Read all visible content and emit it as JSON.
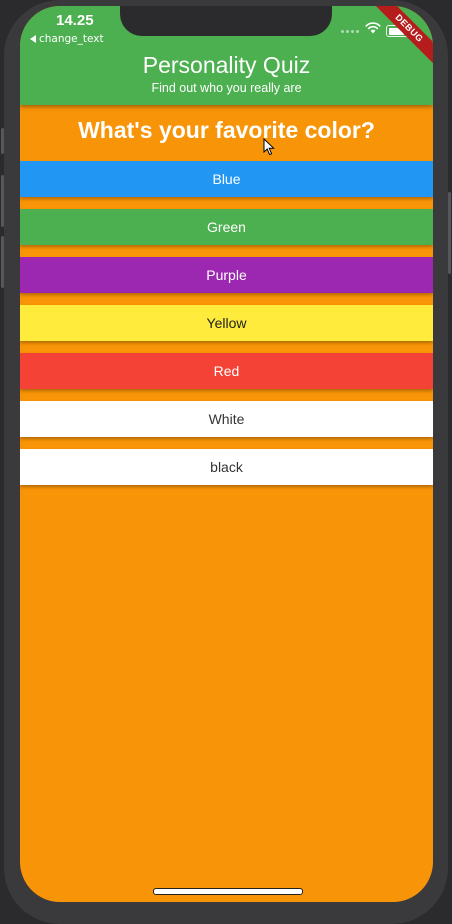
{
  "status_bar": {
    "time": "14.25",
    "back_app_label": "change_text",
    "debug_label": "DEBUG"
  },
  "app_bar": {
    "title": "Personality Quiz",
    "subtitle": "Find out who you really are",
    "color": "#4caf50"
  },
  "quiz": {
    "background": "#f89407",
    "question": "What's your favorite color?",
    "answers": [
      {
        "label": "Blue",
        "bg": "#2196f3",
        "fg": "#ffffff"
      },
      {
        "label": "Green",
        "bg": "#4caf50",
        "fg": "#ffffff"
      },
      {
        "label": "Purple",
        "bg": "#9c27b0",
        "fg": "#ffffff"
      },
      {
        "label": "Yellow",
        "bg": "#ffeb3b",
        "fg": "#222222"
      },
      {
        "label": "Red",
        "bg": "#f44336",
        "fg": "#ffffff"
      },
      {
        "label": "White",
        "bg": "#ffffff",
        "fg": "#333333"
      },
      {
        "label": "black",
        "bg": "#ffffff",
        "fg": "#333333"
      }
    ]
  },
  "icons": {
    "back": "back-triangle-icon",
    "wifi": "wifi-icon",
    "battery": "battery-icon",
    "cursor": "mouse-cursor-icon"
  }
}
